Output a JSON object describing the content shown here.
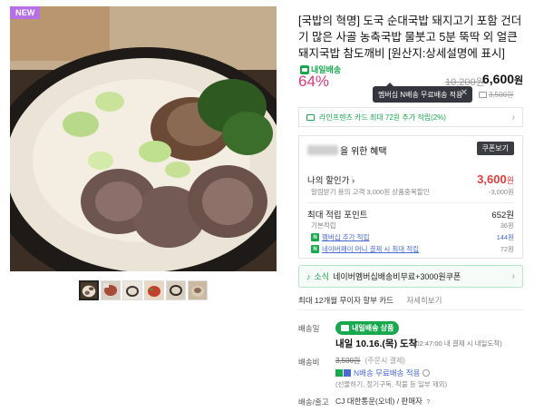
{
  "badge": {
    "new": "NEW"
  },
  "product": {
    "title": "[국밥의 혁명] 도국 순대국밥 돼지고기 포함 건더기 많은 사골 농축국밥 물붓고 5분 뚝딱 외 얼큰 돼지국밥 참도깨비 [원산지:상세설명에 표시]",
    "free_ship_tag": "내일배송"
  },
  "price": {
    "discount_rate": "64%",
    "original": "10,200원",
    "sale_value": "6,600",
    "sale_unit": "원",
    "member_price": "3,500원"
  },
  "tooltip": {
    "text": "멤버십 N배송 무료배송 적용",
    "close": "✕"
  },
  "card_promo": {
    "text": "라인프렌즈 카드 최대 72원 추가 적립(2%)",
    "chevron": "›"
  },
  "benefit": {
    "title_suffix": "을 위한 혜택",
    "coupon_button": "쿠폰보기",
    "my_discount_label": "나의 할인가",
    "my_discount_chevron": "›",
    "my_discount_value": "3,600",
    "my_discount_unit": "원",
    "alarm_label": "알림받기 용의 고객 3,000원 상품중복할인",
    "alarm_value": "-3,000원",
    "points_label": "최대 적립 포인트",
    "points_value": "652원",
    "basic_label": "기본적립",
    "basic_value": "36원",
    "membership_label": "멤버십 추가 적립",
    "membership_value": "144원",
    "money_label": "네이버페이 머니 결제 시 최대 적립",
    "money_value": "72원",
    "nbadge": "N"
  },
  "notice": {
    "prefix": "소식",
    "text_green": "네이버멤버십",
    "text": "배송비무료+3000원쿠폰",
    "chevron": "›"
  },
  "installment": {
    "text": "최대 12개월 무이자 할부 카드",
    "link": "자세히보기"
  },
  "delivery": {
    "date_label": "배송일",
    "badge": "내일배송 상품",
    "arrive": "내일 10.16.(목) 도착",
    "arrive_note": "(02:47:00 내 결제 시 내일도착)",
    "fee_label": "배송비",
    "fee_orig": "3,500원",
    "fee_note_inline": "(주문시 결제)",
    "fee_free": "N배송 무료배송 적용",
    "fee_note": "(선물하기, 정기구독, 착불 등 일부 제외)",
    "courier_label": "배송/출고",
    "courier": "CJ 대한통운(오네) / 판매자",
    "courier_q": "?"
  },
  "icons": [
    "cart-icon",
    "card-icon",
    "chevron-right-icon",
    "close-icon",
    "bell-icon",
    "info-icon",
    "truck-icon"
  ],
  "colors": {
    "discount": "#d63a78",
    "green": "#18a84e",
    "red": "#e03b3b",
    "blue": "#4a6bd6"
  }
}
